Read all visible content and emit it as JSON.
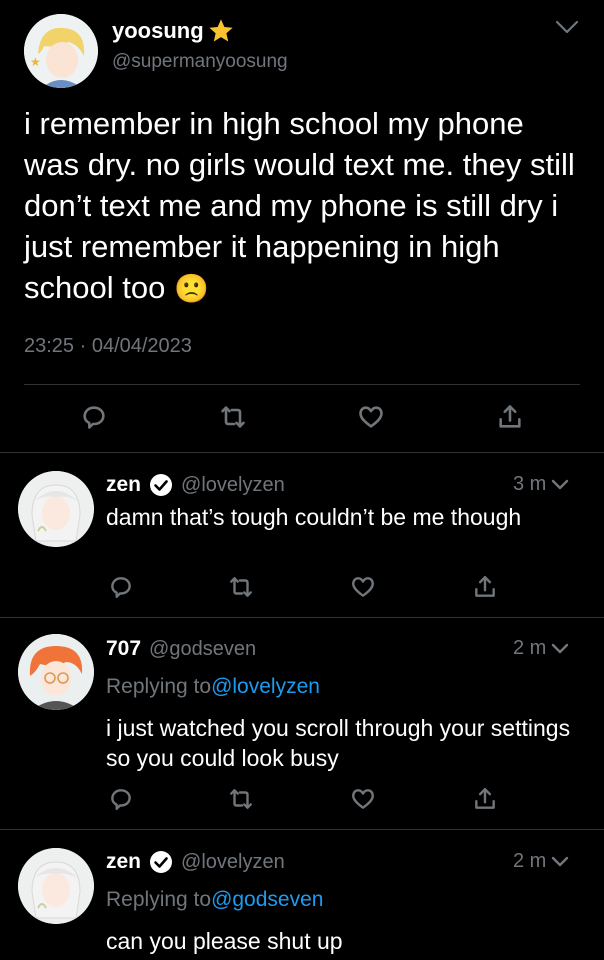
{
  "main_tweet": {
    "name": "yoosung",
    "handle": "@supermanyoosung",
    "text": "i remember in high school my phone was dry. no girls would text me. they still don’t text me and my phone is still dry i just remember it happening in high school too",
    "emoji": "🙁",
    "timestamp": "23:25 · 04/04/2023",
    "name_icon": "star-icon"
  },
  "replies": [
    {
      "name": "zen",
      "handle": "@lovelyzen",
      "time_ago": "3 m",
      "replying_prefix": "",
      "replying_to": "",
      "text": "damn that’s tough couldn’t be me though"
    },
    {
      "name": "707",
      "handle": "@godseven",
      "time_ago": "2 m",
      "replying_prefix": "Replying to",
      "replying_to": "@lovelyzen",
      "text": "i just watched you scroll through your settings so you could look busy"
    },
    {
      "name": "zen",
      "handle": "@lovelyzen",
      "time_ago": "2 m",
      "replying_prefix": "Replying to",
      "replying_to": "@godseven",
      "text": "can you please shut up"
    }
  ],
  "colors": {
    "background": "#000000",
    "muted": "#71767b",
    "link": "#1d9bf0",
    "star": "#f7c32e"
  }
}
